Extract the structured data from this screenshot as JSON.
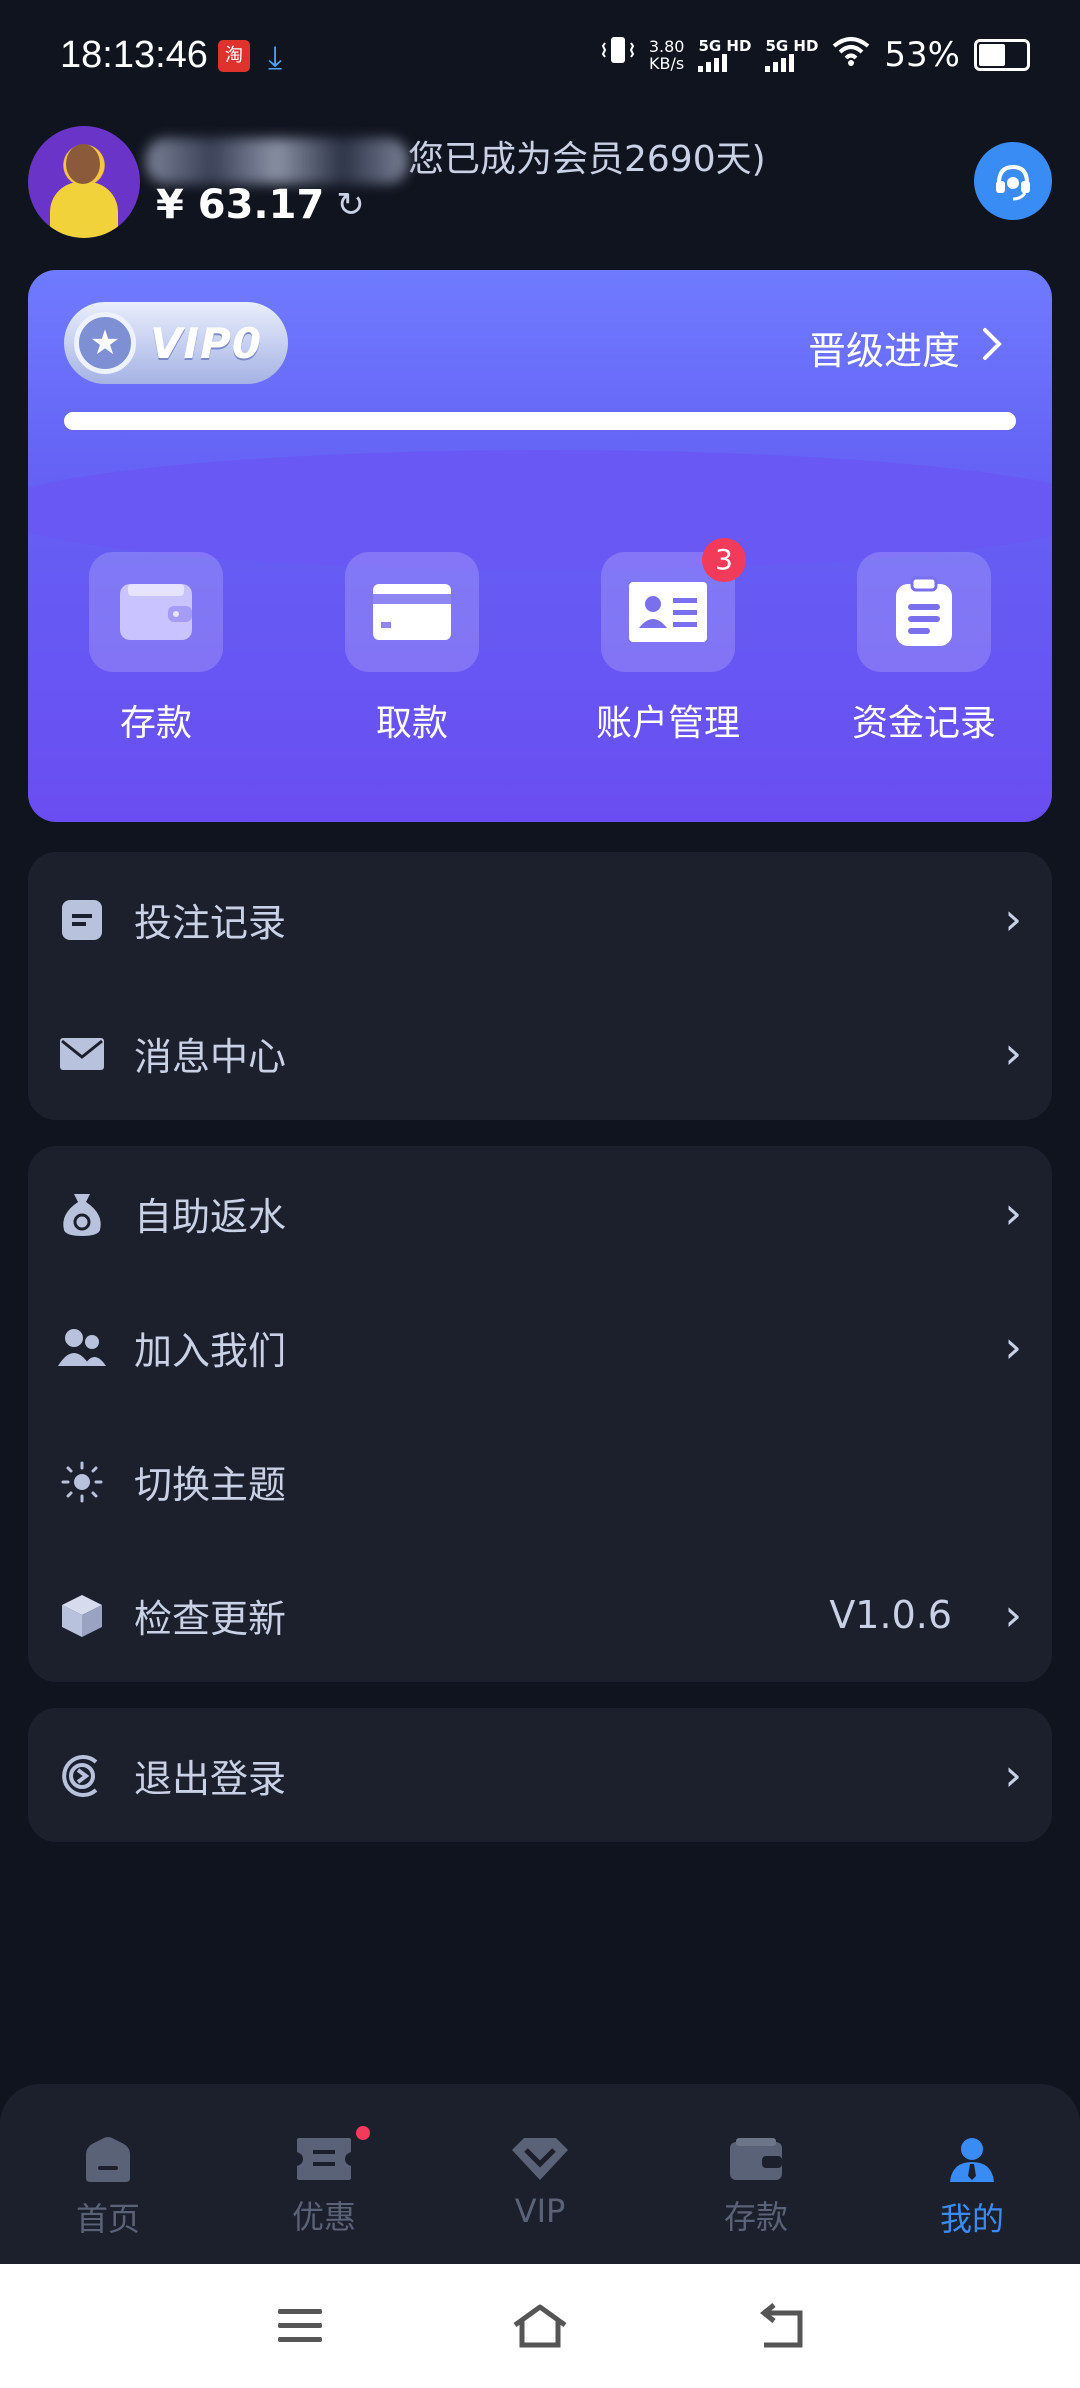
{
  "status_bar": {
    "time": "18:13:46",
    "app_icon_text": "淘",
    "net_speed_value": "3.80",
    "net_speed_unit": "KB/s",
    "sim1": "5G HD",
    "sim2": "5G HD",
    "battery": "53%"
  },
  "profile": {
    "member_text": "您已成为会员2690天)",
    "balance": "¥ 63.17"
  },
  "vip_card": {
    "badge_label": "VIP0",
    "upgrade_label": "晋级进度",
    "progress": 1.0,
    "actions": [
      {
        "label": "存款",
        "icon": "wallet-icon"
      },
      {
        "label": "取款",
        "icon": "card-icon"
      },
      {
        "label": "账户管理",
        "icon": "id-card-icon",
        "badge": "3"
      },
      {
        "label": "资金记录",
        "icon": "clipboard-icon"
      }
    ]
  },
  "menu_groups": [
    [
      {
        "label": "投注记录",
        "icon": "document-icon",
        "chevron": true
      },
      {
        "label": "消息中心",
        "icon": "mail-icon",
        "chevron": true
      }
    ],
    [
      {
        "label": "自助返水",
        "icon": "money-bag-icon",
        "chevron": true
      },
      {
        "label": "加入我们",
        "icon": "users-icon",
        "chevron": true
      },
      {
        "label": "切换主题",
        "icon": "sun-icon",
        "chevron": false
      },
      {
        "label": "检查更新",
        "icon": "cube-icon",
        "chevron": true,
        "value": "V1.0.6"
      }
    ],
    [
      {
        "label": "退出登录",
        "icon": "logout-icon",
        "chevron": true
      }
    ]
  ],
  "tab_bar": {
    "tabs": [
      {
        "label": "首页",
        "icon": "home-icon"
      },
      {
        "label": "优惠",
        "icon": "ticket-icon",
        "dot": true
      },
      {
        "label": "VIP",
        "icon": "diamond-icon"
      },
      {
        "label": "存款",
        "icon": "wallet-icon"
      },
      {
        "label": "我的",
        "icon": "person-icon",
        "active": true
      }
    ]
  },
  "colors": {
    "background": "#10141f",
    "card": "#1c202d",
    "accent": "#3a8cf5",
    "vip_gradient_start": "#6f7bff",
    "vip_gradient_end": "#6a4df2",
    "badge_red": "#f23b5a"
  }
}
